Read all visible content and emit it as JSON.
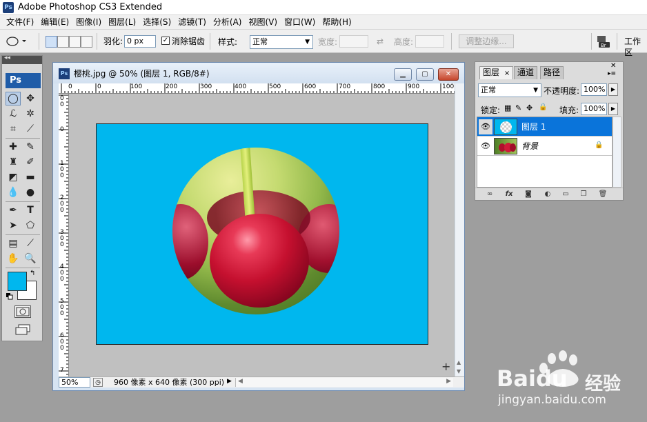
{
  "app": {
    "title": "Adobe Photoshop CS3 Extended",
    "icon_text": "Ps"
  },
  "menu": [
    "文件(F)",
    "编辑(E)",
    "图像(I)",
    "图层(L)",
    "选择(S)",
    "滤镜(T)",
    "分析(A)",
    "视图(V)",
    "窗口(W)",
    "帮助(H)"
  ],
  "options": {
    "feather_label": "羽化:",
    "feather_value": "0 px",
    "antialias_label": "消除锯齿",
    "antialias_checked": true,
    "style_label": "样式:",
    "style_value": "正常",
    "width_label": "宽度:",
    "height_label": "高度:",
    "refine_edge": "调整边缘...",
    "workspace": "工作区",
    "swap_icon": "⇄"
  },
  "toolbox": {
    "logo": "Ps"
  },
  "document": {
    "title": "樱桃.jpg @ 50% (图层 1, RGB/8#)",
    "zoom": "50%",
    "doc_info": "960 像素 x 640 像素 (300 ppi)",
    "ruler_h": [
      "0",
      "0",
      "100",
      "200",
      "300",
      "400",
      "500",
      "600",
      "700",
      "800",
      "900",
      "100"
    ],
    "ruler_v": [
      "0\n0",
      "0",
      "1\n0\n0",
      "2\n0\n0",
      "3\n0\n0",
      "4\n0\n0",
      "5\n0\n0",
      "6\n0\n0",
      "7"
    ],
    "canvas_color": "#00b7ee"
  },
  "layers_panel": {
    "tabs": [
      "图层",
      "通道",
      "路径"
    ],
    "blend_mode": "正常",
    "opacity_label": "不透明度:",
    "opacity_value": "100%",
    "lock_label": "锁定:",
    "fill_label": "填充:",
    "fill_value": "100%",
    "layers": [
      {
        "name": "图层 1",
        "selected": true,
        "visible": true
      },
      {
        "name": "背景",
        "selected": false,
        "visible": true,
        "locked": true
      }
    ]
  },
  "colors": {
    "foreground": "#00b7ee",
    "background": "#ffffff",
    "selection": "#0a74da"
  },
  "watermark": {
    "brand": "Baidu",
    "brand_cn": "经验",
    "url": "jingyan.baidu.com"
  }
}
